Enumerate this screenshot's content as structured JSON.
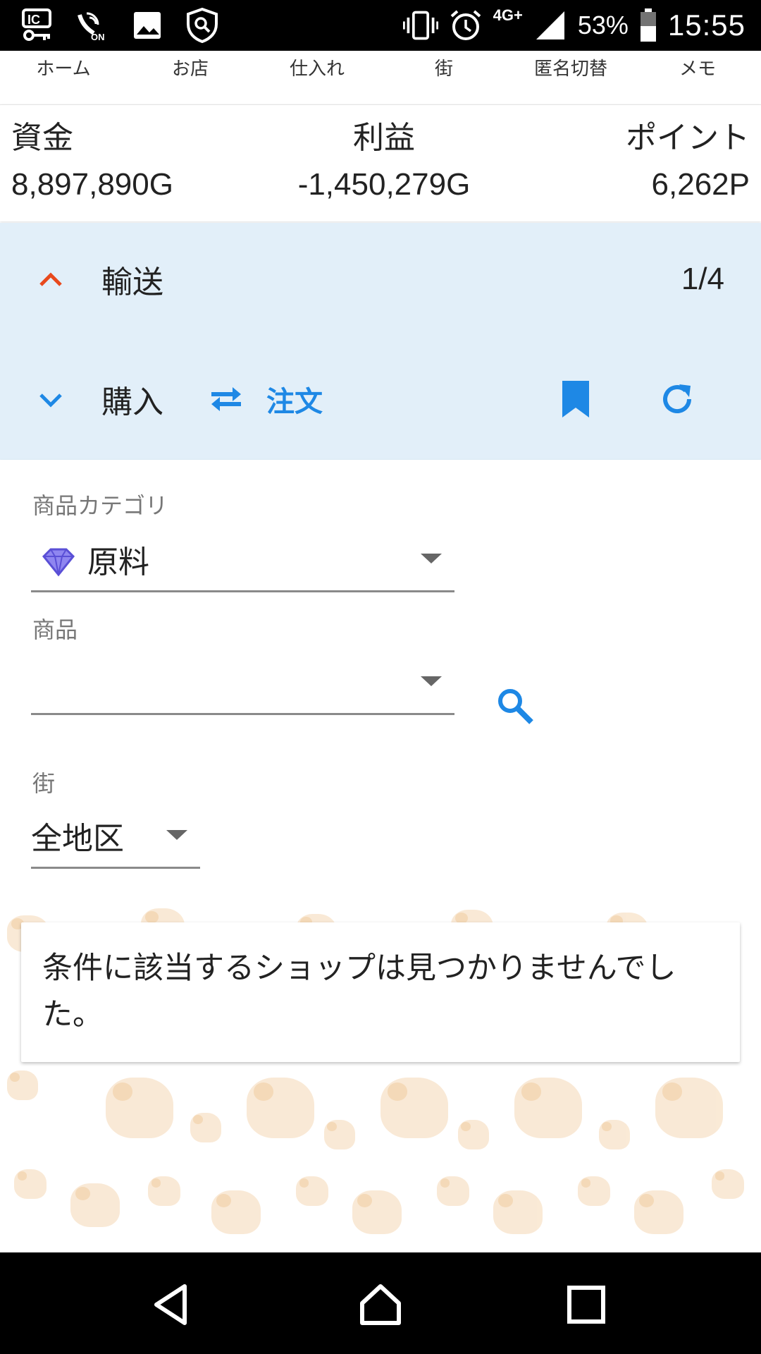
{
  "status_bar": {
    "network": "4G+",
    "battery": "53%",
    "time": "15:55",
    "icons": [
      "nfc-key-icon",
      "wifi-calling-on-icon",
      "image-icon",
      "shield-icon",
      "vibrate-icon",
      "alarm-icon",
      "signal-icon",
      "battery-icon"
    ]
  },
  "top_nav": {
    "items": [
      "ホーム",
      "お店",
      "仕入れ",
      "街",
      "匿名切替",
      "メモ"
    ]
  },
  "stats": {
    "funds_label": "資金",
    "funds_value": "8,897,890G",
    "profit_label": "利益",
    "profit_value": "-1,450,279G",
    "points_label": "ポイント",
    "points_value": "6,262P"
  },
  "transport": {
    "title": "輸送",
    "count": "1/4"
  },
  "purchase": {
    "title": "購入",
    "order_label": "注文"
  },
  "form": {
    "category_label": "商品カテゴリ",
    "category_value": "原料",
    "product_label": "商品",
    "product_value": "",
    "town_label": "街",
    "town_value": "全地区"
  },
  "result": {
    "message": "条件に該当するショップは見つかりませんでした。"
  },
  "colors": {
    "accent_blue": "#1e88e5",
    "accent_red": "#e8491d",
    "panel_bg": "#e2eff9"
  }
}
